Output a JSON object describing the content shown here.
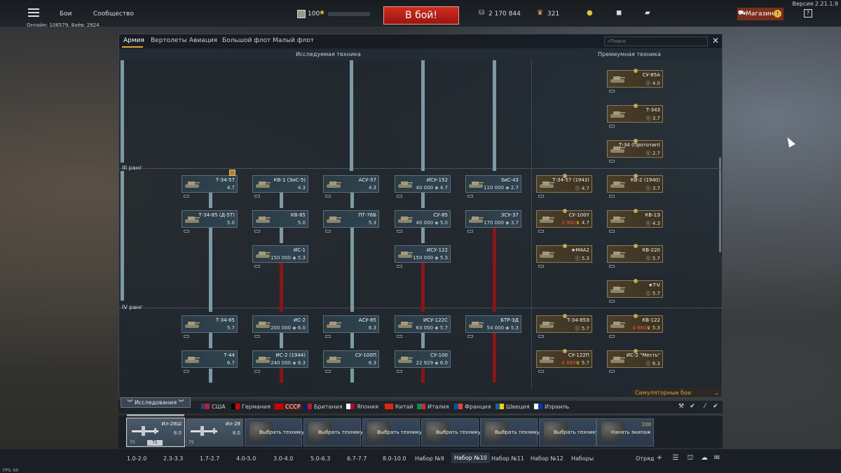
{
  "topbar": {
    "nav_battles": "Бои",
    "nav_community": "Сообщество",
    "online": "Онлайн: 106579, Боёв: 2924",
    "version": "Версия 2.21.1.9",
    "level": "100",
    "battle_button": "В бой!",
    "silver_lions": "2 170 844",
    "eagles": "321",
    "shop_label": "Магазин",
    "shop_alert": "!",
    "help": "?"
  },
  "tabs": [
    {
      "label": "Армия",
      "active": true
    },
    {
      "label": "Вертолеты",
      "active": false
    },
    {
      "label": "Авиация",
      "active": false
    },
    {
      "label": "Большой флот",
      "active": false
    },
    {
      "label": "Малый флот",
      "active": false
    }
  ],
  "search": {
    "placeholder": "Поиск"
  },
  "sections": {
    "researched": "Исследуемая техника",
    "premium": "Премиумная техника"
  },
  "ranks": {
    "r3": "III ранг",
    "r4": "IV ранг"
  },
  "vehicles": [
    {
      "name": "Т-34-57",
      "info": "4.7"
    },
    {
      "name": "КВ-1 (ЗиС-5)",
      "info": "4.3"
    },
    {
      "name": "АСУ-57",
      "info": "4.3"
    },
    {
      "name": "ИСУ-152",
      "info": "40 000 ◈ 4.7"
    },
    {
      "name": "ЗиС-43",
      "info": "110 000 ◈ 2.7"
    },
    {
      "name": "Т-34-85 (Д-5Т)",
      "info": "5.0"
    },
    {
      "name": "КВ-85",
      "info": "5.0"
    },
    {
      "name": "ПТ-76Б",
      "info": "5.3"
    },
    {
      "name": "СУ-85",
      "info": "40 000 ◈ 5.0"
    },
    {
      "name": "ЗСУ-37",
      "info": "170 000 ◈ 3.7"
    },
    {
      "name": "ИС-1",
      "info": "150 000 ◈ 5.3"
    },
    {
      "name": "ИСУ-122",
      "info": "150 000 ◈ 5.3"
    },
    {
      "name": "Т-34-85",
      "info": "5.7"
    },
    {
      "name": "ИС-2",
      "info": "200 000 ◈ 6.0"
    },
    {
      "name": "АСУ-85",
      "info": "6.3"
    },
    {
      "name": "ИСУ-122С",
      "info": "63 000 ◈ 5.7"
    },
    {
      "name": "БТР-ЗД",
      "info": "54 000 ◈ 5.3"
    },
    {
      "name": "Т-44",
      "info": "6.7"
    },
    {
      "name": "ИС-2 (1944)",
      "info": "240 000 ◈ 6.3"
    },
    {
      "name": "СУ-100П",
      "info": "6.3"
    },
    {
      "name": "СУ-100",
      "info": "22 929 ◈ 6.0"
    }
  ],
  "premium_vehicles": [
    {
      "name": "СУ-85А",
      "info": "4.0"
    },
    {
      "name": "Т-343",
      "info": "3.7"
    },
    {
      "name": "Т-34 (Прототип)",
      "info": "2.7"
    },
    {
      "name": "Т-34-57 (1943)",
      "info": "4.7"
    },
    {
      "name": "КВ-2 (1940)",
      "info": "3.7"
    },
    {
      "name": "СУ-100Y",
      "info": "4.7",
      "price": "2 980"
    },
    {
      "name": "КВ-1Э",
      "info": "4.3"
    },
    {
      "name": "★M4A2",
      "info": "5.3"
    },
    {
      "name": "КВ-220",
      "info": "5.7"
    },
    {
      "name": "★T-V",
      "info": "5.7"
    },
    {
      "name": "Т-34-85Э",
      "info": "5.7"
    },
    {
      "name": "КВ-122",
      "info": "5.3",
      "price": "4 880"
    },
    {
      "name": "СУ-122П",
      "info": "5.7",
      "price": "4 880"
    },
    {
      "name": "ИС-2 \"Месть\"",
      "info": "6.3"
    }
  ],
  "game_mode": "Симуляторные бои",
  "research_button": "Исследования",
  "nations": [
    {
      "label": "США",
      "colors": [
        "#3c3b6e",
        "#b22234"
      ]
    },
    {
      "label": "Германия",
      "colors": [
        "#000000",
        "#dd0000"
      ]
    },
    {
      "label": "СССР",
      "colors": [
        "#cc0000",
        "#cc0000"
      ],
      "active": true
    },
    {
      "label": "Британия",
      "colors": [
        "#012169",
        "#c8102e"
      ]
    },
    {
      "label": "Япония",
      "colors": [
        "#ffffff",
        "#bc002d"
      ]
    },
    {
      "label": "Китай",
      "colors": [
        "#de2910",
        "#de2910"
      ]
    },
    {
      "label": "Италия",
      "colors": [
        "#009246",
        "#ce2b37"
      ]
    },
    {
      "label": "Франция",
      "colors": [
        "#0055a4",
        "#ef4135"
      ]
    },
    {
      "label": "Швеция",
      "colors": [
        "#006aa7",
        "#fecc00"
      ]
    },
    {
      "label": "Израиль",
      "colors": [
        "#ffffff",
        "#0038b8"
      ]
    }
  ],
  "slots": [
    {
      "name": "Ил-28Ш",
      "br": "8.0",
      "count": "75",
      "tag": "Т1"
    },
    {
      "name": "Ил-28",
      "br": "8.0",
      "count": "75"
    },
    {
      "label": "Выбрать технику"
    },
    {
      "label": "Выбрать технику"
    },
    {
      "label": "Выбрать технику"
    },
    {
      "label": "Выбрать технику"
    },
    {
      "label": "Выбрать технику"
    },
    {
      "label": "Выбрать технику"
    },
    {
      "label": "Нанять экипаж",
      "price": "200"
    }
  ],
  "presets": [
    "1.0-2.0",
    "2.3-3.3",
    "1.7-2.7",
    "4.0-5.0",
    "3.0-4.0",
    "5.0-6.3",
    "6.7-7.7",
    "8.0-10.0",
    "Набор №9",
    "Набор №10",
    "Набор №11",
    "Набор №12",
    "Наборы"
  ],
  "squad": "Отряд",
  "fps": "FPS: 60"
}
